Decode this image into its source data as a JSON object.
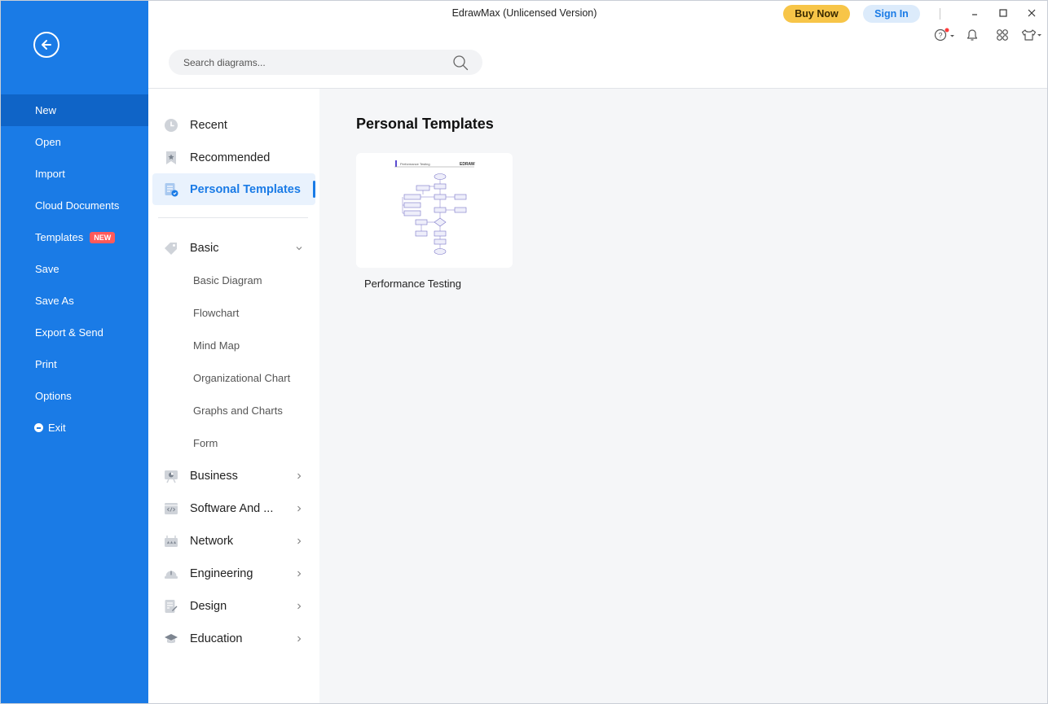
{
  "window": {
    "title": "EdrawMax (Unlicensed Version)",
    "buy_now": "Buy Now",
    "sign_in": "Sign In"
  },
  "search": {
    "placeholder": "Search diagrams..."
  },
  "leftbar": {
    "items": [
      {
        "label": "New"
      },
      {
        "label": "Open"
      },
      {
        "label": "Import"
      },
      {
        "label": "Cloud Documents"
      },
      {
        "label": "Templates",
        "badge": "NEW"
      },
      {
        "label": "Save"
      },
      {
        "label": "Save As"
      },
      {
        "label": "Export & Send"
      },
      {
        "label": "Print"
      },
      {
        "label": "Options"
      },
      {
        "label": "Exit"
      }
    ]
  },
  "categories": {
    "top": [
      {
        "label": "Recent",
        "icon": "clock-icon"
      },
      {
        "label": "Recommended",
        "icon": "star-bookmark-icon"
      },
      {
        "label": "Personal Templates",
        "icon": "personal-template-icon"
      }
    ],
    "basic": {
      "label": "Basic",
      "icon": "tag-icon",
      "items": [
        "Basic Diagram",
        "Flowchart",
        "Mind Map",
        "Organizational Chart",
        "Graphs and Charts",
        "Form"
      ]
    },
    "groups": [
      {
        "label": "Business",
        "icon": "business-icon"
      },
      {
        "label": "Software And ...",
        "icon": "code-icon"
      },
      {
        "label": "Network",
        "icon": "network-icon"
      },
      {
        "label": "Engineering",
        "icon": "hardhat-icon"
      },
      {
        "label": "Design",
        "icon": "design-icon"
      },
      {
        "label": "Education",
        "icon": "graduation-cap-icon"
      }
    ]
  },
  "main": {
    "title": "Personal Templates",
    "templates": [
      {
        "name": "Performance Testing",
        "thumb_header": "Performance Testing",
        "thumb_logo": "EDRAW"
      }
    ]
  },
  "colors": {
    "accent": "#1a7be6",
    "sidebar": "#1a7be6",
    "buy_now": "#f7c548",
    "badge": "#ff5a5a"
  }
}
